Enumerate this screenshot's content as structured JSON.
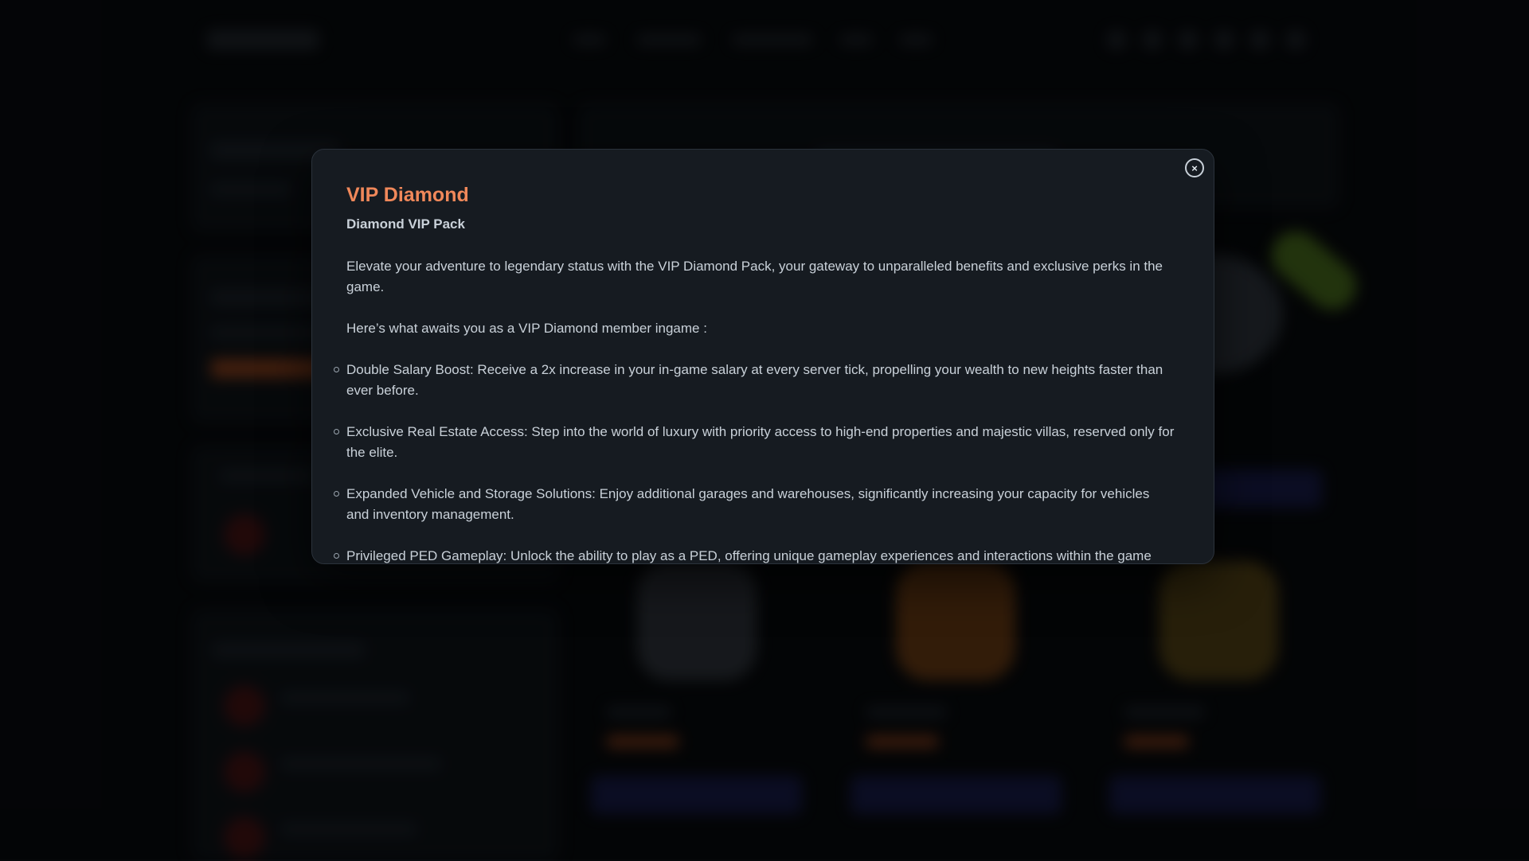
{
  "modal": {
    "close_icon": "×",
    "title": "VIP Diamond",
    "subtitle": "Diamond VIP Pack",
    "intro": "Elevate your adventure to legendary status with the VIP Diamond Pack, your gateway to unparalleled benefits and exclusive perks in the game.",
    "lead": "Here’s what awaits you as a VIP Diamond member ingame :",
    "perks": [
      "Double Salary Boost: Receive a 2x increase in your in-game salary at every server tick, propelling your wealth to new heights faster than ever before.",
      "Exclusive Real Estate Access: Step into the world of luxury with priority access to high-end properties and majestic villas, reserved only for the elite.",
      "Expanded Vehicle and Storage Solutions: Enjoy additional garages and warehouses, significantly increasing your capacity for vehicles and inventory management.",
      "Privileged PED Gameplay: Unlock the ability to play as a PED, offering unique gameplay experiences and interactions within the game"
    ]
  },
  "colors": {
    "accent_title": "#f0885a",
    "modal_bg": "#161b21",
    "page_bg": "#06080a"
  },
  "icons": {
    "close": "close-icon",
    "bullet": "circle-bullet-icon"
  }
}
